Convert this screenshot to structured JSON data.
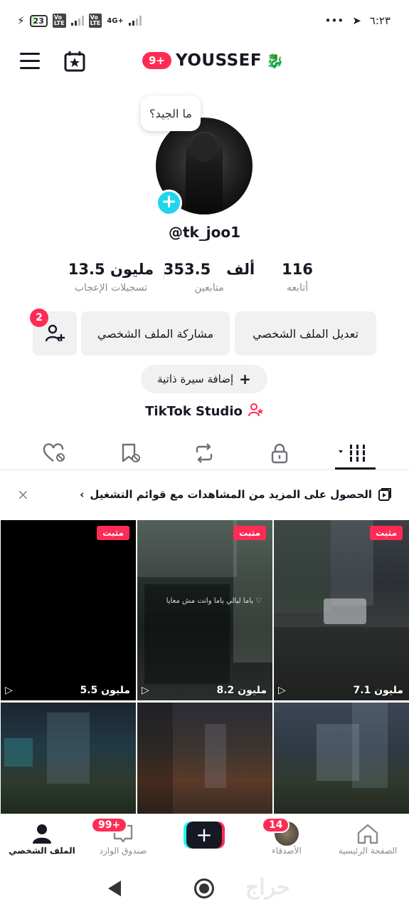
{
  "status_bar": {
    "battery": "23",
    "network": "4G+",
    "time": "٦:٢٣",
    "more": "•••"
  },
  "header": {
    "notification_count": "9+",
    "title": "YOUSSEF"
  },
  "profile": {
    "bubble": "ما الجيد؟",
    "handle": "@tk_joo1",
    "stats": {
      "following": {
        "value": "116",
        "label": "أتابعه"
      },
      "followers": {
        "value": "353.5",
        "unit": "ألف",
        "label": "متابعين"
      },
      "likes": {
        "value": "13.5",
        "unit": "مليون",
        "label": "تسجيلات الإعجاب"
      }
    },
    "buttons": {
      "edit": "تعديل الملف الشخصي",
      "share": "مشاركة الملف الشخصي",
      "friend_requests": "2",
      "add_bio": "إضافة سيرة ذاتية"
    },
    "studio": "TikTok Studio"
  },
  "banner": {
    "text": "الحصول على المزيد من المشاهدات مع قوائم التشغيل",
    "chevron": "‹",
    "close": "×"
  },
  "videos": [
    {
      "pinned": "مثبت",
      "views": "5.5 مليون"
    },
    {
      "pinned": "مثبت",
      "views": "8.2 مليون",
      "caption": "ياما ليالي ياما وانت مش معايا ♡"
    },
    {
      "pinned": "مثبت",
      "views": "7.1 مليون"
    },
    {},
    {},
    {}
  ],
  "bottom_nav": {
    "home": "الصفحة الرئيسية",
    "friends": "الأصدقاء",
    "friends_badge": "14",
    "create": "+",
    "inbox": "صندوق الوارد",
    "inbox_badge": "99+",
    "profile": "الملف الشخصي"
  },
  "colors": {
    "accent": "#fe2c55",
    "cyan": "#25f4ee",
    "text": "#161823",
    "muted": "#8a8b91"
  }
}
